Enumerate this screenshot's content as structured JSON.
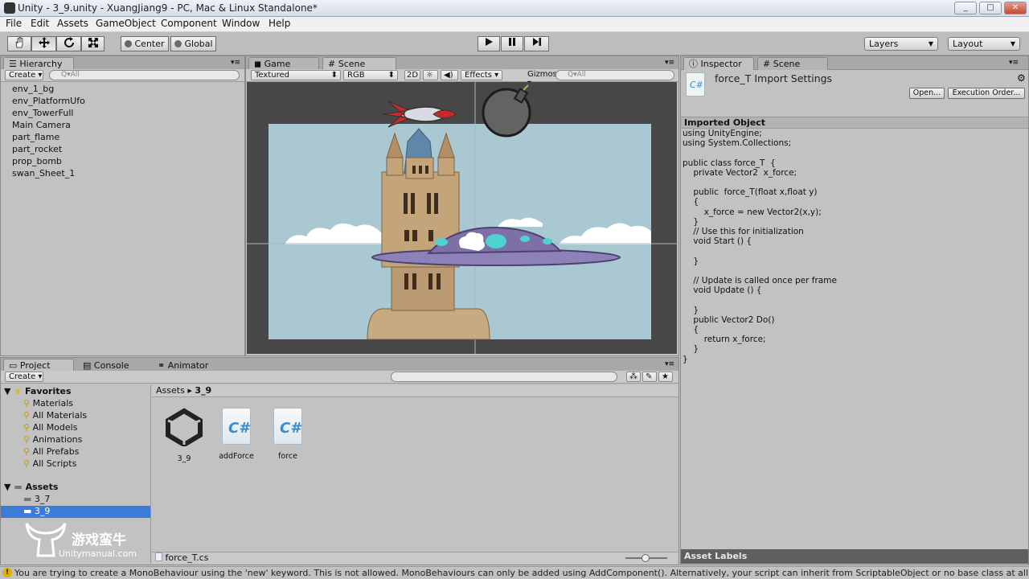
{
  "window": {
    "title": "Unity - 3_9.unity - XuangJiang9 - PC, Mac & Linux Standalone*",
    "controls": [
      "_",
      "□",
      "✕"
    ]
  },
  "menu": [
    "File",
    "Edit",
    "Assets",
    "GameObject",
    "Component",
    "Window",
    "Help"
  ],
  "toolbar": {
    "pivot": "Center",
    "space": "Global",
    "layers": "Layers",
    "layout": "Layout"
  },
  "hierarchy": {
    "tab": "Hierarchy",
    "create": "Create",
    "search_placeholder": "Q▾All",
    "items": [
      "env_1_bg",
      "env_PlatformUfo",
      "env_TowerFull",
      "Main Camera",
      "part_flame",
      "part_rocket",
      "prop_bomb",
      "swan_Sheet_1"
    ]
  },
  "scene": {
    "tab_game": "Game",
    "tab_scene": "Scene",
    "shading": "Textured",
    "render": "RGB",
    "mode2d": "2D",
    "effects": "Effects",
    "gizmos": "Gizmos",
    "search_placeholder": "Q▾All"
  },
  "inspector": {
    "tab_inspector": "Inspector",
    "tab_scene": "Scene",
    "title": "force_T Import Settings",
    "open_button": "Open...",
    "exec_button": "Execution Order...",
    "section": "Imported Object",
    "code": "using UnityEngine;\nusing System.Collections;\n\npublic class force_T  {\n    private Vector2  x_force;\n\n    public  force_T(float x,float y)\n    {\n        x_force = new Vector2(x,y);\n    }\n    // Use this for initialization\n    void Start () {\n\n    }\n\n    // Update is called once per frame\n    void Update () {\n\n    }\n    public Vector2 Do()\n    {\n        return x_force;\n    }\n}",
    "asset_labels": "Asset Labels"
  },
  "project": {
    "tab_project": "Project",
    "tab_console": "Console",
    "tab_animator": "Animator",
    "create": "Create",
    "favorites_label": "Favorites",
    "favorites": [
      "Materials",
      "All Materials",
      "All Models",
      "Animations",
      "All Prefabs",
      "All Scripts"
    ],
    "assets_label": "Assets",
    "folders": [
      "3_7",
      "3_9"
    ],
    "breadcrumb_root": "Assets",
    "breadcrumb_sep": "▸",
    "breadcrumb_current": "3_9",
    "files": [
      {
        "name": "3_9",
        "icon": "unity-scene-icon"
      },
      {
        "name": "addForce",
        "icon": "csharp-script-icon"
      },
      {
        "name": "force",
        "icon": "csharp-script-icon"
      }
    ],
    "selected_file": "force_T.cs"
  },
  "watermark": {
    "brand": "游戏蛮牛",
    "url": "Unitymanual.com"
  },
  "status": "You are trying to create a MonoBehaviour using the 'new' keyword.  This is not allowed.  MonoBehaviours can only be added using AddComponent().  Alternatively, your script can inherit from ScriptableObject or no base class at all"
}
